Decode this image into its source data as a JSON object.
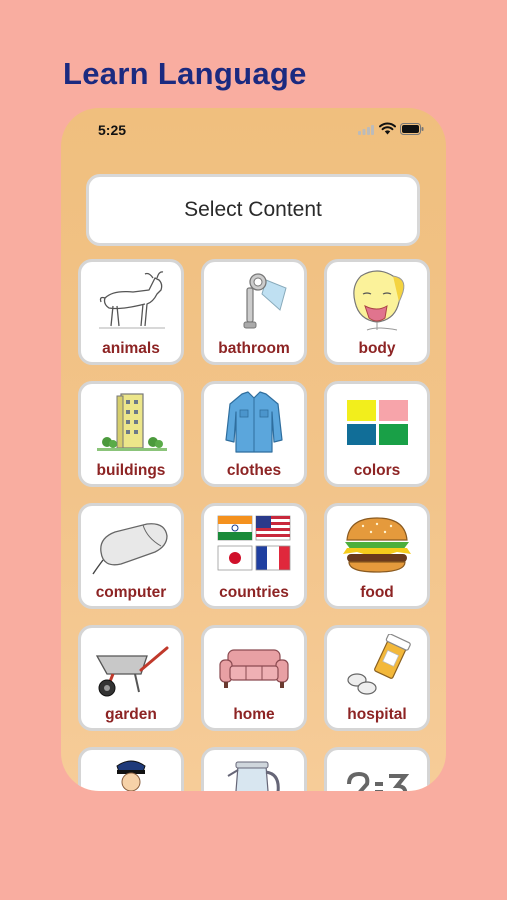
{
  "header": {
    "title": "Learn Language"
  },
  "status_bar": {
    "time": "5:25"
  },
  "select_button": {
    "label": "Select Content"
  },
  "categories": [
    {
      "label": "animals",
      "icon": "goat-icon"
    },
    {
      "label": "bathroom",
      "icon": "shower-icon"
    },
    {
      "label": "body",
      "icon": "face-icon"
    },
    {
      "label": "buildings",
      "icon": "building-icon"
    },
    {
      "label": "clothes",
      "icon": "shirt-icon"
    },
    {
      "label": "colors",
      "icon": "color-squares-icon"
    },
    {
      "label": "computer",
      "icon": "mouse-icon"
    },
    {
      "label": "countries",
      "icon": "flags-icon"
    },
    {
      "label": "food",
      "icon": "burger-icon"
    },
    {
      "label": "garden",
      "icon": "wheelbarrow-icon"
    },
    {
      "label": "home",
      "icon": "sofa-icon"
    },
    {
      "label": "hospital",
      "icon": "pills-icon"
    },
    {
      "label": "",
      "icon": "police-officer-icon"
    },
    {
      "label": "",
      "icon": "kettle-icon"
    },
    {
      "label": "",
      "icon": "numbers-icon"
    }
  ],
  "colors": {
    "background": "#f9ada0",
    "title": "#1b2a80",
    "label": "#8d2424",
    "phone_bg": "#f0bf7e"
  }
}
